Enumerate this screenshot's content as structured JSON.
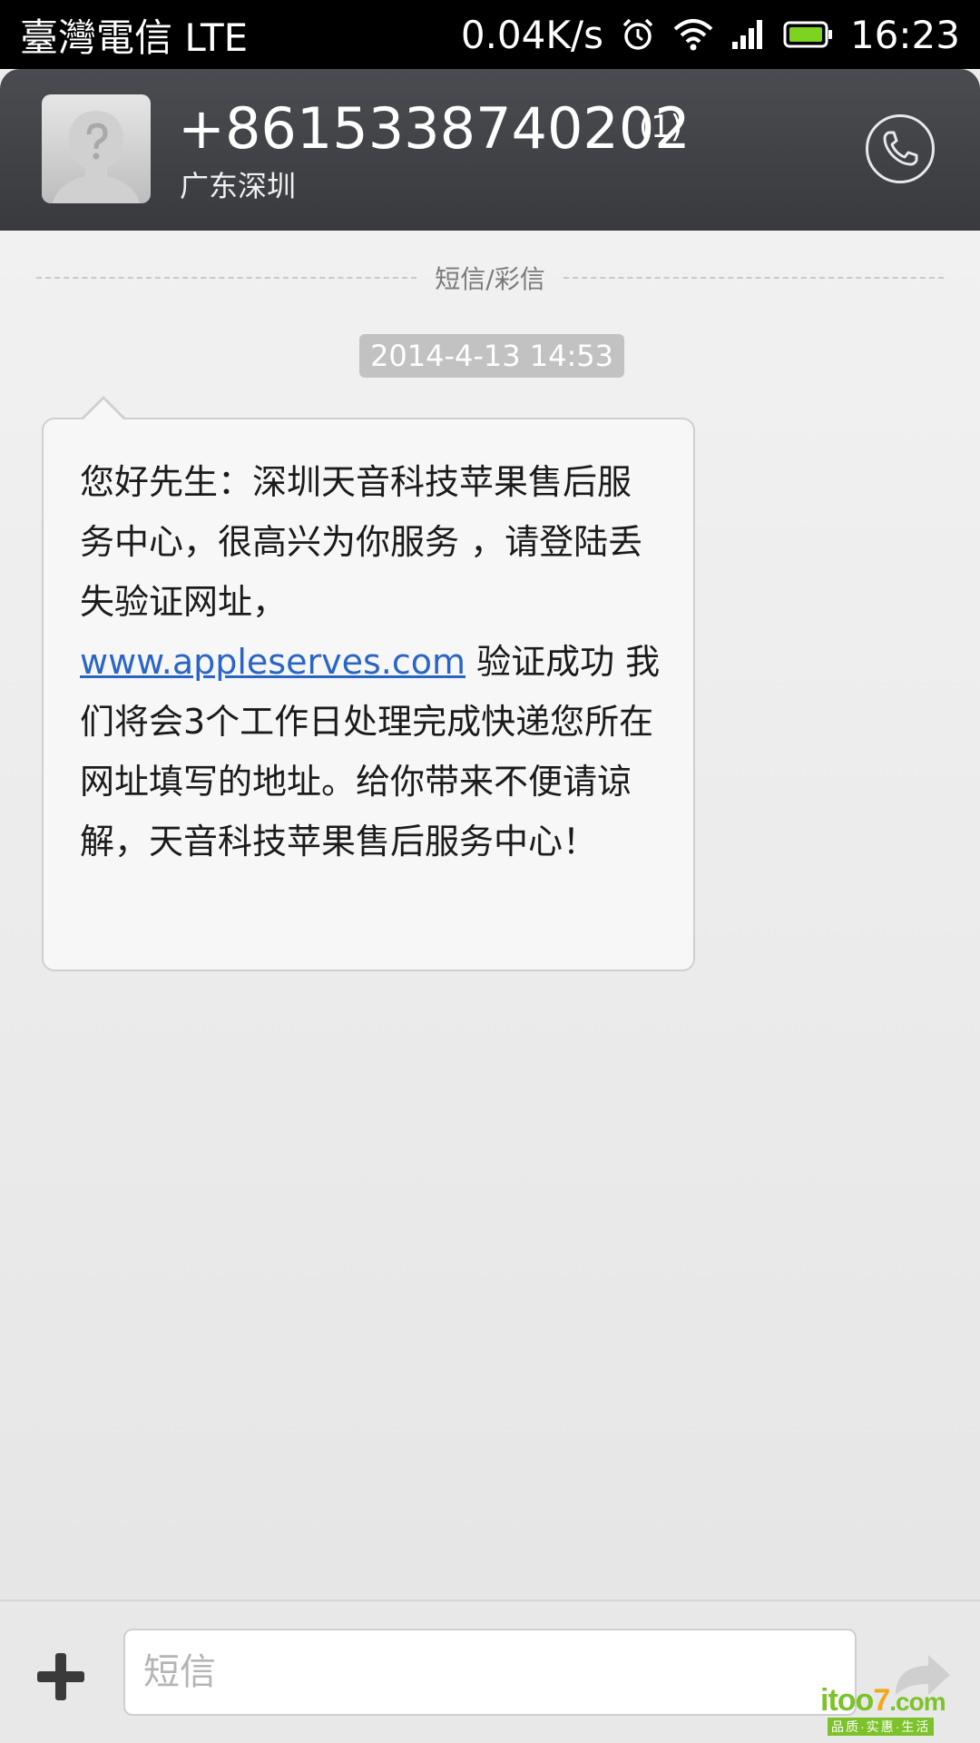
{
  "status_bar": {
    "carrier": "臺灣電信 LTE",
    "speed": "0.04K/s",
    "time": "16:23",
    "icons": [
      "alarm-icon",
      "wifi-icon",
      "signal-icon",
      "battery-icon"
    ],
    "battery_color": "#7ed321"
  },
  "header": {
    "contact_number": "+8615338740202",
    "message_count": "(1)",
    "location": "广东深圳",
    "background_color": "#3d3f43"
  },
  "conversation": {
    "channel_label": "短信/彩信",
    "timestamp": "2014-4-13 14:53",
    "message": {
      "text_before_link": "您好先生：深圳天音科技苹果售后服务中心，很高兴为你服务 ，请登陆丢失验证网址，",
      "link": "www.appleserves.com",
      "text_after_link": " 验证成功 我们将会3个工作日处理完成快递您所在网址填写的地址。给你带来不便请谅解，天音科技苹果售后服务中心！",
      "link_color": "#2a65c6"
    }
  },
  "composer": {
    "placeholder": "短信",
    "value": ""
  },
  "watermark": {
    "part_i": "i",
    "part_too": "too",
    "part_7": "7",
    "part_com": ".com",
    "tagline": "品质·实惠·生活"
  }
}
